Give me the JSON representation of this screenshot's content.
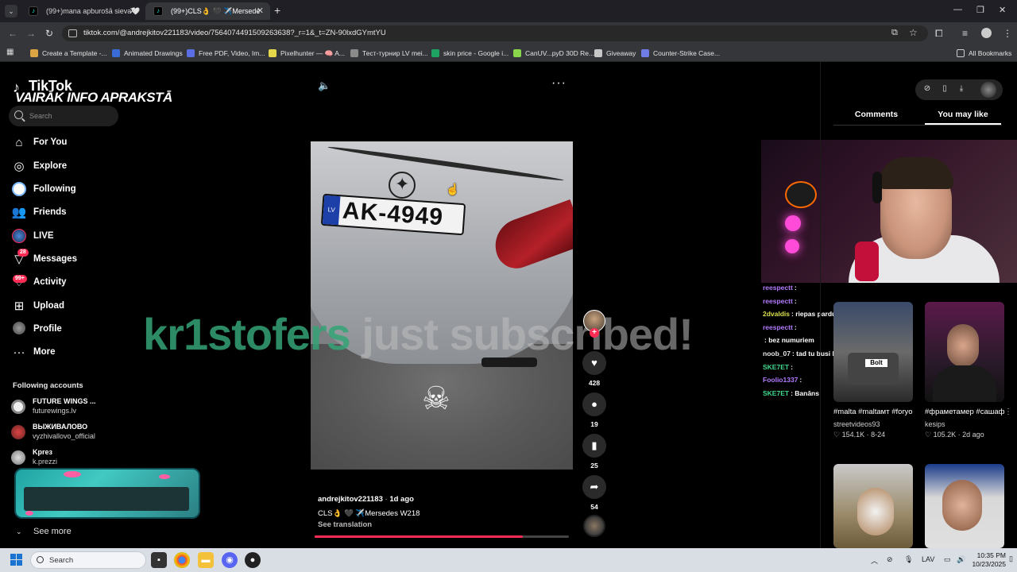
{
  "browser": {
    "tabs": [
      {
        "title": "(99+)mana apburošā sieva🤍",
        "active": false
      },
      {
        "title": "(99+)CLS👌 🖤 ✈️Mersede",
        "active": true
      }
    ],
    "new_tab_glyph": "+",
    "url": "tiktok.com/@andrejkitov221183/video/7564074491509263638?_r=1&_t=ZN-90lxdGYmtYU",
    "bookmarks": [
      {
        "label": "Create a Template -...",
        "color": "#d9a441"
      },
      {
        "label": "Animated Drawings",
        "color": "#3b6bd6"
      },
      {
        "label": "Free PDF, Video, Im...",
        "color": "#5b6ee6"
      },
      {
        "label": "Pixelhunter — 🧠 A...",
        "color": "#e6d84b"
      },
      {
        "label": "Тест-турнир LV mei...",
        "color": "#8a8a8a"
      },
      {
        "label": "skin price - Google i...",
        "color": "#1ea362"
      },
      {
        "label": "CanUV...pyD 30D Re...",
        "color": "#8ad64b"
      },
      {
        "label": "Giveaway",
        "color": "#c7c7c7"
      },
      {
        "label": "Counter-Strike Case...",
        "color": "#6f7de6"
      }
    ],
    "all_bookmarks": "All Bookmarks"
  },
  "sidebar": {
    "logo": "TikTok",
    "search_placeholder": "Search",
    "nav": [
      {
        "label": "For You",
        "icon": "home-icon"
      },
      {
        "label": "Explore",
        "icon": "compass-icon"
      },
      {
        "label": "Following",
        "icon": "following-icon"
      },
      {
        "label": "Friends",
        "icon": "friends-icon"
      },
      {
        "label": "LIVE",
        "icon": "live-icon"
      },
      {
        "label": "Messages",
        "icon": "messages-icon",
        "badge": "28"
      },
      {
        "label": "Activity",
        "icon": "activity-icon",
        "badge": "99+"
      },
      {
        "label": "Upload",
        "icon": "upload-icon"
      },
      {
        "label": "Profile",
        "icon": "profile-icon"
      },
      {
        "label": "More",
        "icon": "more-icon"
      }
    ],
    "following_title": "Following accounts",
    "following": [
      {
        "name": "FUTURE WINGS ...",
        "handle": "futurewings.lv"
      },
      {
        "name": "ВЫЖИВАЛОВО",
        "handle": "vyzhivallovo_official"
      },
      {
        "name": "Kpreз",
        "handle": "k.prezzi"
      }
    ],
    "see_more": "See more"
  },
  "promo_banner": {
    "text": "VAIRĀK INFO APRAKSTĀ"
  },
  "video": {
    "plate_country": "LV",
    "plate": "AK-4949",
    "overlay_user": "kr1stofers",
    "overlay_rest": " just subscribed!",
    "author": "andrejkitov221183",
    "posted": "1d ago",
    "caption": "CLS👌 🖤 ✈️Mersedes W218",
    "see_translation": "See translation",
    "progress": 0.82,
    "actions": {
      "likes": "428",
      "comments": "19",
      "saves": "25",
      "shares": "54"
    }
  },
  "stream": {
    "chat": [
      {
        "user": "reespectt",
        "msg": ":",
        "color": "#b47bff"
      },
      {
        "user": "reespectt",
        "msg": ":",
        "color": "#b47bff"
      },
      {
        "user": "2dvaldis",
        "msg": ": riepas pardursu",
        "color": "#d8e04b"
      },
      {
        "user": "reespectt",
        "msg": ":",
        "color": "#b47bff"
      },
      {
        "user": "",
        "msg": ": bez numuriem",
        "color": "#ff5a5a"
      },
      {
        "user": "noob_07",
        "msg": ": tad tu busi boss",
        "color": "#e6e6e6"
      },
      {
        "user": "SKE7ET",
        "msg": ":",
        "color": "#3fd88c"
      },
      {
        "user": "Foolio1337",
        "msg": ":",
        "color": "#b47bff"
      },
      {
        "user": "SKE7ET",
        "msg": ": Banāns",
        "color": "#3fd88c"
      }
    ]
  },
  "right_panel": {
    "tabs": [
      "Comments",
      "You may like"
    ],
    "active_tab": 1,
    "cards": [
      {
        "title": "#malta #maltaмт #foryou...",
        "author": "streetvideos93",
        "likes": "154.1K",
        "date": "8-24"
      },
      {
        "title": "#фраметамер #сашафраметам...",
        "author": "kesips",
        "likes": "105.2K",
        "date": "2d ago"
      },
      {
        "title": "",
        "author": "",
        "likes": "",
        "date": ""
      },
      {
        "title": "",
        "author": "",
        "likes": "",
        "date": ""
      }
    ]
  },
  "taskbar": {
    "search": "Search",
    "lang": "LAV",
    "time": "10:35 PM",
    "date": "10/23/2025"
  }
}
